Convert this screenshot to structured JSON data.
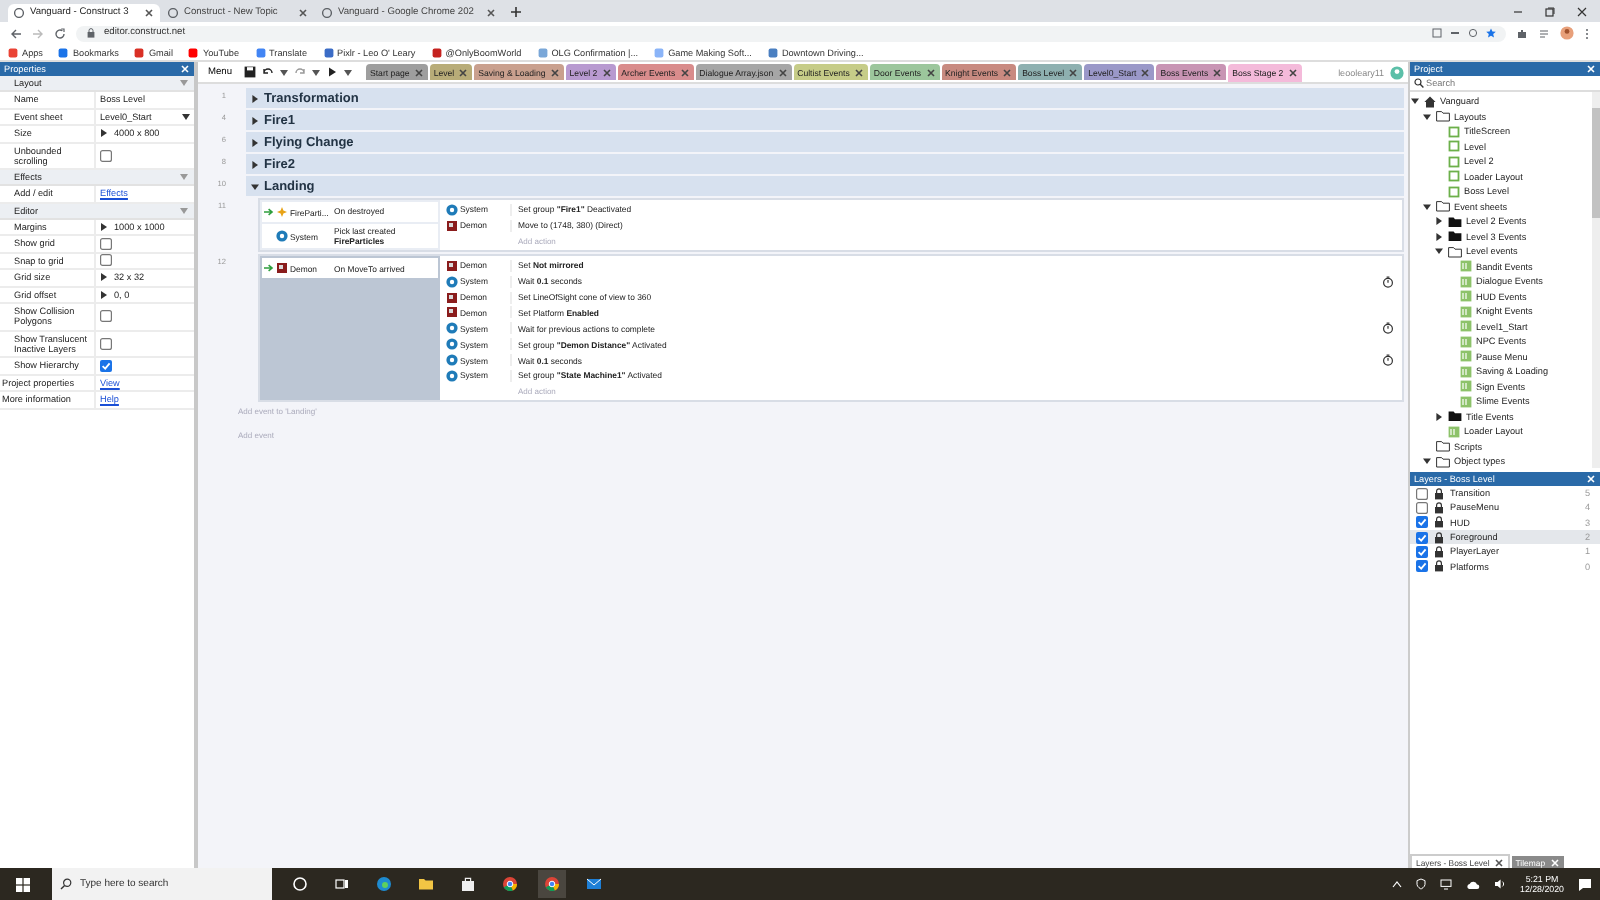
{
  "browser": {
    "tabs": [
      {
        "title": "Vanguard - Construct 3",
        "selected": true
      },
      {
        "title": "Construct - New Topic",
        "selected": false
      },
      {
        "title": "Vanguard - Google Chrome 202",
        "selected": false
      }
    ],
    "url": "editor.construct.net",
    "bookmarks": [
      "Apps",
      "Bookmarks",
      "Gmail",
      "YouTube",
      "Translate",
      "Pixlr - Leo O' Leary",
      "@OnlyBoomWorld",
      "OLG Confirmation |...",
      "Game Making Soft...",
      "Downtown Driving..."
    ]
  },
  "properties": {
    "title": "Properties",
    "sections": [
      {
        "title": "Layout",
        "rows": [
          {
            "label": "Name",
            "kind": "text",
            "value": "Boss Level"
          },
          {
            "label": "Event sheet",
            "kind": "dropdown",
            "value": "Level0_Start"
          },
          {
            "label": "Size",
            "kind": "expand",
            "value": "4000 x 800"
          },
          {
            "label": "Unbounded scrolling",
            "kind": "checkbox",
            "checked": false
          }
        ]
      },
      {
        "title": "Effects",
        "rows": [
          {
            "label": "Add / edit",
            "kind": "link",
            "value": "Effects"
          }
        ]
      },
      {
        "title": "Editor",
        "rows": [
          {
            "label": "Margins",
            "kind": "expand",
            "value": "1000 x 1000"
          },
          {
            "label": "Show grid",
            "kind": "checkbox",
            "checked": false
          },
          {
            "label": "Snap to grid",
            "kind": "checkbox",
            "checked": false
          },
          {
            "label": "Grid size",
            "kind": "expand",
            "value": "32 x 32"
          },
          {
            "label": "Grid offset",
            "kind": "expand",
            "value": "0, 0"
          },
          {
            "label": "Show Collision Polygons",
            "kind": "checkbox",
            "checked": false
          },
          {
            "label": "Show Translucent Inactive Layers",
            "kind": "checkbox",
            "checked": false
          },
          {
            "label": "Show Hierarchy",
            "kind": "checkbox",
            "checked": true
          }
        ]
      }
    ],
    "footer_rows": [
      {
        "label": "Project properties",
        "kind": "link",
        "value": "View"
      },
      {
        "label": "More information",
        "kind": "link",
        "value": "Help"
      }
    ]
  },
  "editor": {
    "menu": "Menu",
    "sheet_tabs": [
      {
        "label": "Start page",
        "color": "#9e9e9e",
        "selected": false
      },
      {
        "label": "Level",
        "color": "#b8ac78",
        "selected": false
      },
      {
        "label": "Saving & Loading",
        "color": "#c9a08e",
        "selected": false
      },
      {
        "label": "Level 2",
        "color": "#b89ad0",
        "selected": false
      },
      {
        "label": "Archer Events",
        "color": "#d98c8c",
        "selected": false
      },
      {
        "label": "Dialogue Array.json",
        "color": "#a6a6a6",
        "selected": false
      },
      {
        "label": "Cultist Events",
        "color": "#c6cc88",
        "selected": false
      },
      {
        "label": "Door Events",
        "color": "#9cc69c",
        "selected": false
      },
      {
        "label": "Knight Events",
        "color": "#c88a80",
        "selected": false
      },
      {
        "label": "Boss Level",
        "color": "#8eb0b0",
        "selected": false
      },
      {
        "label": "Level0_Start",
        "color": "#9a98c8",
        "selected": false
      },
      {
        "label": "Boss Events",
        "color": "#c894b4",
        "selected": false
      },
      {
        "label": "Boss Stage 2",
        "color": "#f4bada",
        "selected": true
      }
    ],
    "user": "leooleary11",
    "groups": [
      {
        "line": "1",
        "title": "Transformation",
        "expanded": false
      },
      {
        "line": "4",
        "title": "Fire1",
        "expanded": false
      },
      {
        "line": "6",
        "title": "Flying Change",
        "expanded": false
      },
      {
        "line": "8",
        "title": "Fire2",
        "expanded": false
      },
      {
        "line": "10",
        "title": "Landing",
        "expanded": true,
        "events": [
          {
            "line": "11",
            "selected": false,
            "conditions": [
              {
                "object": "FireParti...",
                "kind": "particles",
                "text": "On destroyed",
                "trigger": true
              },
              {
                "object": "System",
                "kind": "system",
                "text": "Pick last created **FireParticles**",
                "trigger": false
              }
            ],
            "actions": [
              {
                "object": "System",
                "kind": "system",
                "text": "Set group **\"Fire1\"** Deactivated",
                "waits": false
              },
              {
                "object": "Demon",
                "kind": "sprite",
                "text": "Move to (1748, 380) (Direct)",
                "waits": false
              }
            ],
            "add_action": "Add action"
          },
          {
            "line": "12",
            "selected": true,
            "conditions": [
              {
                "object": "Demon",
                "kind": "sprite",
                "text": "On MoveTo arrived",
                "trigger": true
              }
            ],
            "actions": [
              {
                "object": "Demon",
                "kind": "sprite",
                "text": "Set **Not mirrored**",
                "waits": false
              },
              {
                "object": "System",
                "kind": "system",
                "text": "Wait **0.1** seconds",
                "waits": true
              },
              {
                "object": "Demon",
                "kind": "sprite",
                "text": "Set LineOfSight cone of view to 360",
                "waits": false
              },
              {
                "object": "Demon",
                "kind": "sprite",
                "text": "Set Platform **Enabled**",
                "waits": false
              },
              {
                "object": "System",
                "kind": "system",
                "text": "Wait for previous actions to complete",
                "waits": true
              },
              {
                "object": "System",
                "kind": "system",
                "text": "Set group **\"Demon Distance\"** Activated",
                "waits": false
              },
              {
                "object": "System",
                "kind": "system",
                "text": "Wait **0.1** seconds",
                "waits": true
              },
              {
                "object": "System",
                "kind": "system",
                "text": "Set group **\"State Machine1\"** Activated",
                "waits": false
              }
            ],
            "add_action": "Add action"
          }
        ],
        "add_event": "Add event to 'Landing'"
      }
    ],
    "add_event": "Add event"
  },
  "project": {
    "title": "Project",
    "search": {
      "placeholder": "Search"
    },
    "tree": [
      {
        "label": "Vanguard",
        "kind": "project",
        "expanded": true,
        "children": [
          {
            "label": "Layouts",
            "kind": "folder",
            "expanded": true,
            "children": [
              {
                "label": "TitleScreen",
                "kind": "layout"
              },
              {
                "label": "Level",
                "kind": "layout"
              },
              {
                "label": "Level 2",
                "kind": "layout"
              },
              {
                "label": "Loader Layout",
                "kind": "layout"
              },
              {
                "label": "Boss Level",
                "kind": "layout"
              }
            ]
          },
          {
            "label": "Event sheets",
            "kind": "folder",
            "expanded": true,
            "children": [
              {
                "label": "Level 2 Events",
                "kind": "folder",
                "expanded": false
              },
              {
                "label": "Level 3 Events",
                "kind": "folder",
                "expanded": false
              },
              {
                "label": "Level events",
                "kind": "folder",
                "expanded": true,
                "children": [
                  {
                    "label": "Bandit Events",
                    "kind": "sheet"
                  },
                  {
                    "label": "Dialogue Events",
                    "kind": "sheet"
                  },
                  {
                    "label": "HUD Events",
                    "kind": "sheet"
                  },
                  {
                    "label": "Knight Events",
                    "kind": "sheet"
                  },
                  {
                    "label": "Level1_Start",
                    "kind": "sheet"
                  },
                  {
                    "label": "NPC Events",
                    "kind": "sheet"
                  },
                  {
                    "label": "Pause Menu",
                    "kind": "sheet"
                  },
                  {
                    "label": "Saving & Loading",
                    "kind": "sheet"
                  },
                  {
                    "label": "Sign Events",
                    "kind": "sheet"
                  },
                  {
                    "label": "Slime Events",
                    "kind": "sheet"
                  }
                ]
              },
              {
                "label": "Title Events",
                "kind": "folder",
                "expanded": false
              },
              {
                "label": "Loader Layout",
                "kind": "sheet"
              }
            ]
          },
          {
            "label": "Scripts",
            "kind": "folder"
          },
          {
            "label": "Object types",
            "kind": "folder",
            "expanded": true
          }
        ]
      }
    ]
  },
  "layers": {
    "title": "Layers - Boss Level",
    "items": [
      {
        "name": "Transition",
        "visible": false,
        "number": "5",
        "selected": false
      },
      {
        "name": "PauseMenu",
        "visible": false,
        "number": "4",
        "selected": false
      },
      {
        "name": "HUD",
        "visible": true,
        "number": "3",
        "selected": false
      },
      {
        "name": "Foreground",
        "visible": true,
        "number": "2",
        "selected": true
      },
      {
        "name": "PlayerLayer",
        "visible": true,
        "number": "1",
        "selected": false
      },
      {
        "name": "Platforms",
        "visible": true,
        "number": "0",
        "selected": false
      }
    ]
  },
  "bottom_tabs": [
    {
      "label": "Layers - Boss Level",
      "selected": true
    },
    {
      "label": "Tilemap",
      "selected": false
    }
  ],
  "taskbar": {
    "search": {
      "placeholder": "Type here to search"
    },
    "time": "5:21 PM",
    "date": "12/28/2020"
  }
}
